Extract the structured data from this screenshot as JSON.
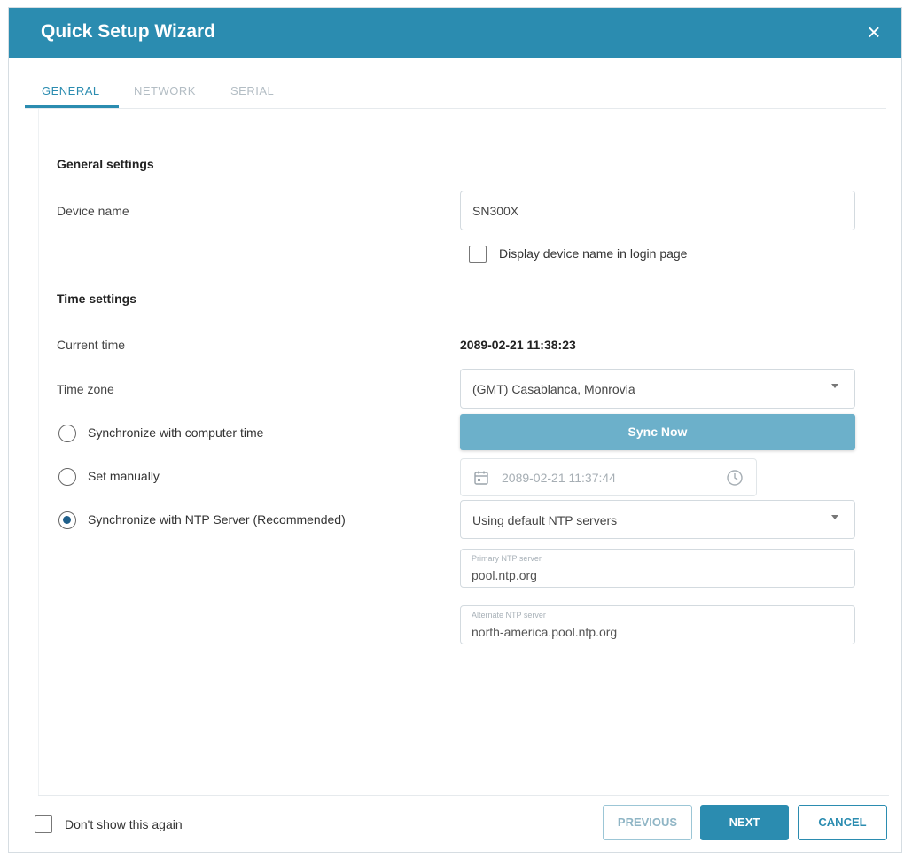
{
  "dialog": {
    "title": "Quick Setup Wizard",
    "close_icon": "×"
  },
  "tabs": [
    {
      "label": "GENERAL",
      "active": true
    },
    {
      "label": "NETWORK",
      "active": false
    },
    {
      "label": "SERIAL",
      "active": false
    }
  ],
  "general": {
    "section_title": "General settings",
    "device_name_label": "Device name",
    "device_name_value": "SN300X",
    "display_in_login_label": "Display device name in login page",
    "display_in_login_checked": false
  },
  "time": {
    "section_title": "Time settings",
    "current_time_label": "Current time",
    "current_time_value": "2089-02-21 11:38:23",
    "time_zone_label": "Time zone",
    "time_zone_value": "(GMT) Casablanca, Monrovia",
    "sync_computer_label": "Synchronize with computer time",
    "sync_now_label": "Sync Now",
    "set_manually_label": "Set manually",
    "manual_datetime_value": "2089-02-21 11:37:44",
    "sync_ntp_label": "Synchronize with NTP Server (Recommended)",
    "selected_option": "ntp",
    "ntp_mode_value": "Using default NTP servers",
    "primary_ntp_label": "Primary NTP server",
    "primary_ntp_value": "pool.ntp.org",
    "alternate_ntp_label": "Alternate NTP server",
    "alternate_ntp_value": "north-america.pool.ntp.org"
  },
  "footer": {
    "dont_show_label": "Don't show this again",
    "dont_show_checked": false,
    "previous_label": "PREVIOUS",
    "next_label": "NEXT",
    "cancel_label": "CANCEL"
  },
  "colors": {
    "accent": "#2b8cb0",
    "sync_button": "#6cb0ca",
    "radio_selected": "#1f5f8a"
  },
  "icons": {
    "close": "close-icon",
    "calendar": "calendar-icon",
    "clock": "clock-icon",
    "dropdown": "chevron-down-icon"
  }
}
